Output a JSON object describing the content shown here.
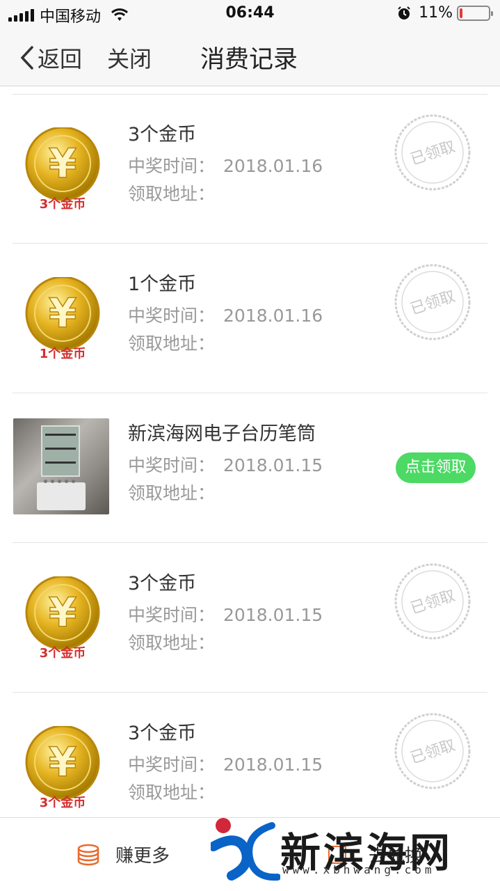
{
  "status_bar": {
    "carrier": "中国移动",
    "time": "06:44",
    "battery": "11%",
    "battery_level": 0.11,
    "battery_color": "#e53935"
  },
  "nav": {
    "back_label": "返回",
    "close_label": "关闭",
    "title": "消费记录"
  },
  "records": [
    {
      "title": "3个金币",
      "time_label": "中奖时间：",
      "time_value": "2018.01.16",
      "addr_label": "领取地址：",
      "coin_caption": "3个金币",
      "status": "已领取"
    },
    {
      "title": "1个金币",
      "time_label": "中奖时间：",
      "time_value": "2018.01.16",
      "addr_label": "领取地址：",
      "coin_caption": "1个金币",
      "status": "已领取"
    },
    {
      "title": "新滨海网电子台历笔筒",
      "time_label": "中奖时间：",
      "time_value": "2018.01.15",
      "addr_label": "领取地址：",
      "button": "点击领取"
    },
    {
      "title": "3个金币",
      "time_label": "中奖时间：",
      "time_value": "2018.01.15",
      "addr_label": "领取地址：",
      "coin_caption": "3个金币",
      "status": "已领取"
    },
    {
      "title": "3个金币",
      "time_label": "中奖时间：",
      "time_value": "2018.01.15",
      "addr_label": "领取地址：",
      "coin_caption": "3个金币",
      "status": "已领取"
    }
  ],
  "bottom_bar": {
    "earn_label": "赚更多",
    "tab2_label": "去兑换"
  },
  "watermark": {
    "text": "新滨海网",
    "url": "www.xbhwang.com"
  },
  "colors": {
    "claim_button": "#4cd964",
    "coin_gold": "#e6b422",
    "coin_caption": "#d32f2f",
    "accent_orange": "#e86a2c"
  }
}
